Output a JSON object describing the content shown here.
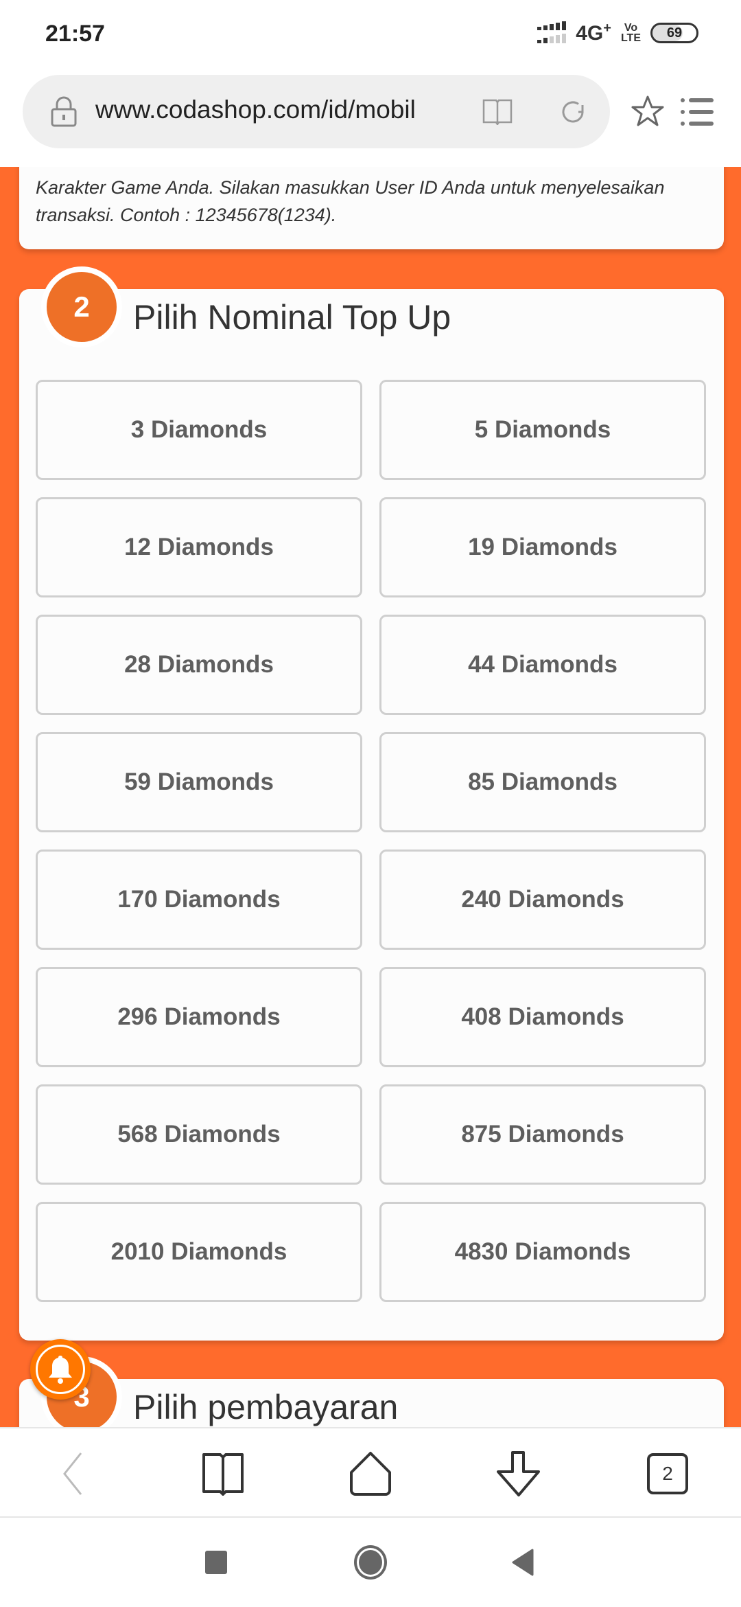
{
  "status_bar": {
    "time": "21:57",
    "network": "4G",
    "network_plus": "+",
    "volte_top": "Vo",
    "volte_bottom": "LTE",
    "battery": "69",
    "battery_level_percent": 69
  },
  "browser": {
    "url": "www.codashop.com/id/mobil",
    "tab_count": "2"
  },
  "page": {
    "step1_hint": "Karakter Game Anda. Silakan masukkan User ID Anda untuk menyelesaikan transaksi. Contoh : 12345678(1234).",
    "step2": {
      "number": "2",
      "title": "Pilih Nominal Top Up",
      "options": [
        "3 Diamonds",
        "5 Diamonds",
        "12 Diamonds",
        "19 Diamonds",
        "28 Diamonds",
        "44 Diamonds",
        "59 Diamonds",
        "85 Diamonds",
        "170 Diamonds",
        "240 Diamonds",
        "296 Diamonds",
        "408 Diamonds",
        "568 Diamonds",
        "875 Diamonds",
        "2010 Diamonds",
        "4830 Diamonds"
      ]
    },
    "step3": {
      "number": "3",
      "title": "Pilih pembayaran"
    }
  },
  "colors": {
    "accent_orange": "#ff6b2c",
    "badge_orange": "#ee7027",
    "bell_orange": "#ff7700"
  }
}
